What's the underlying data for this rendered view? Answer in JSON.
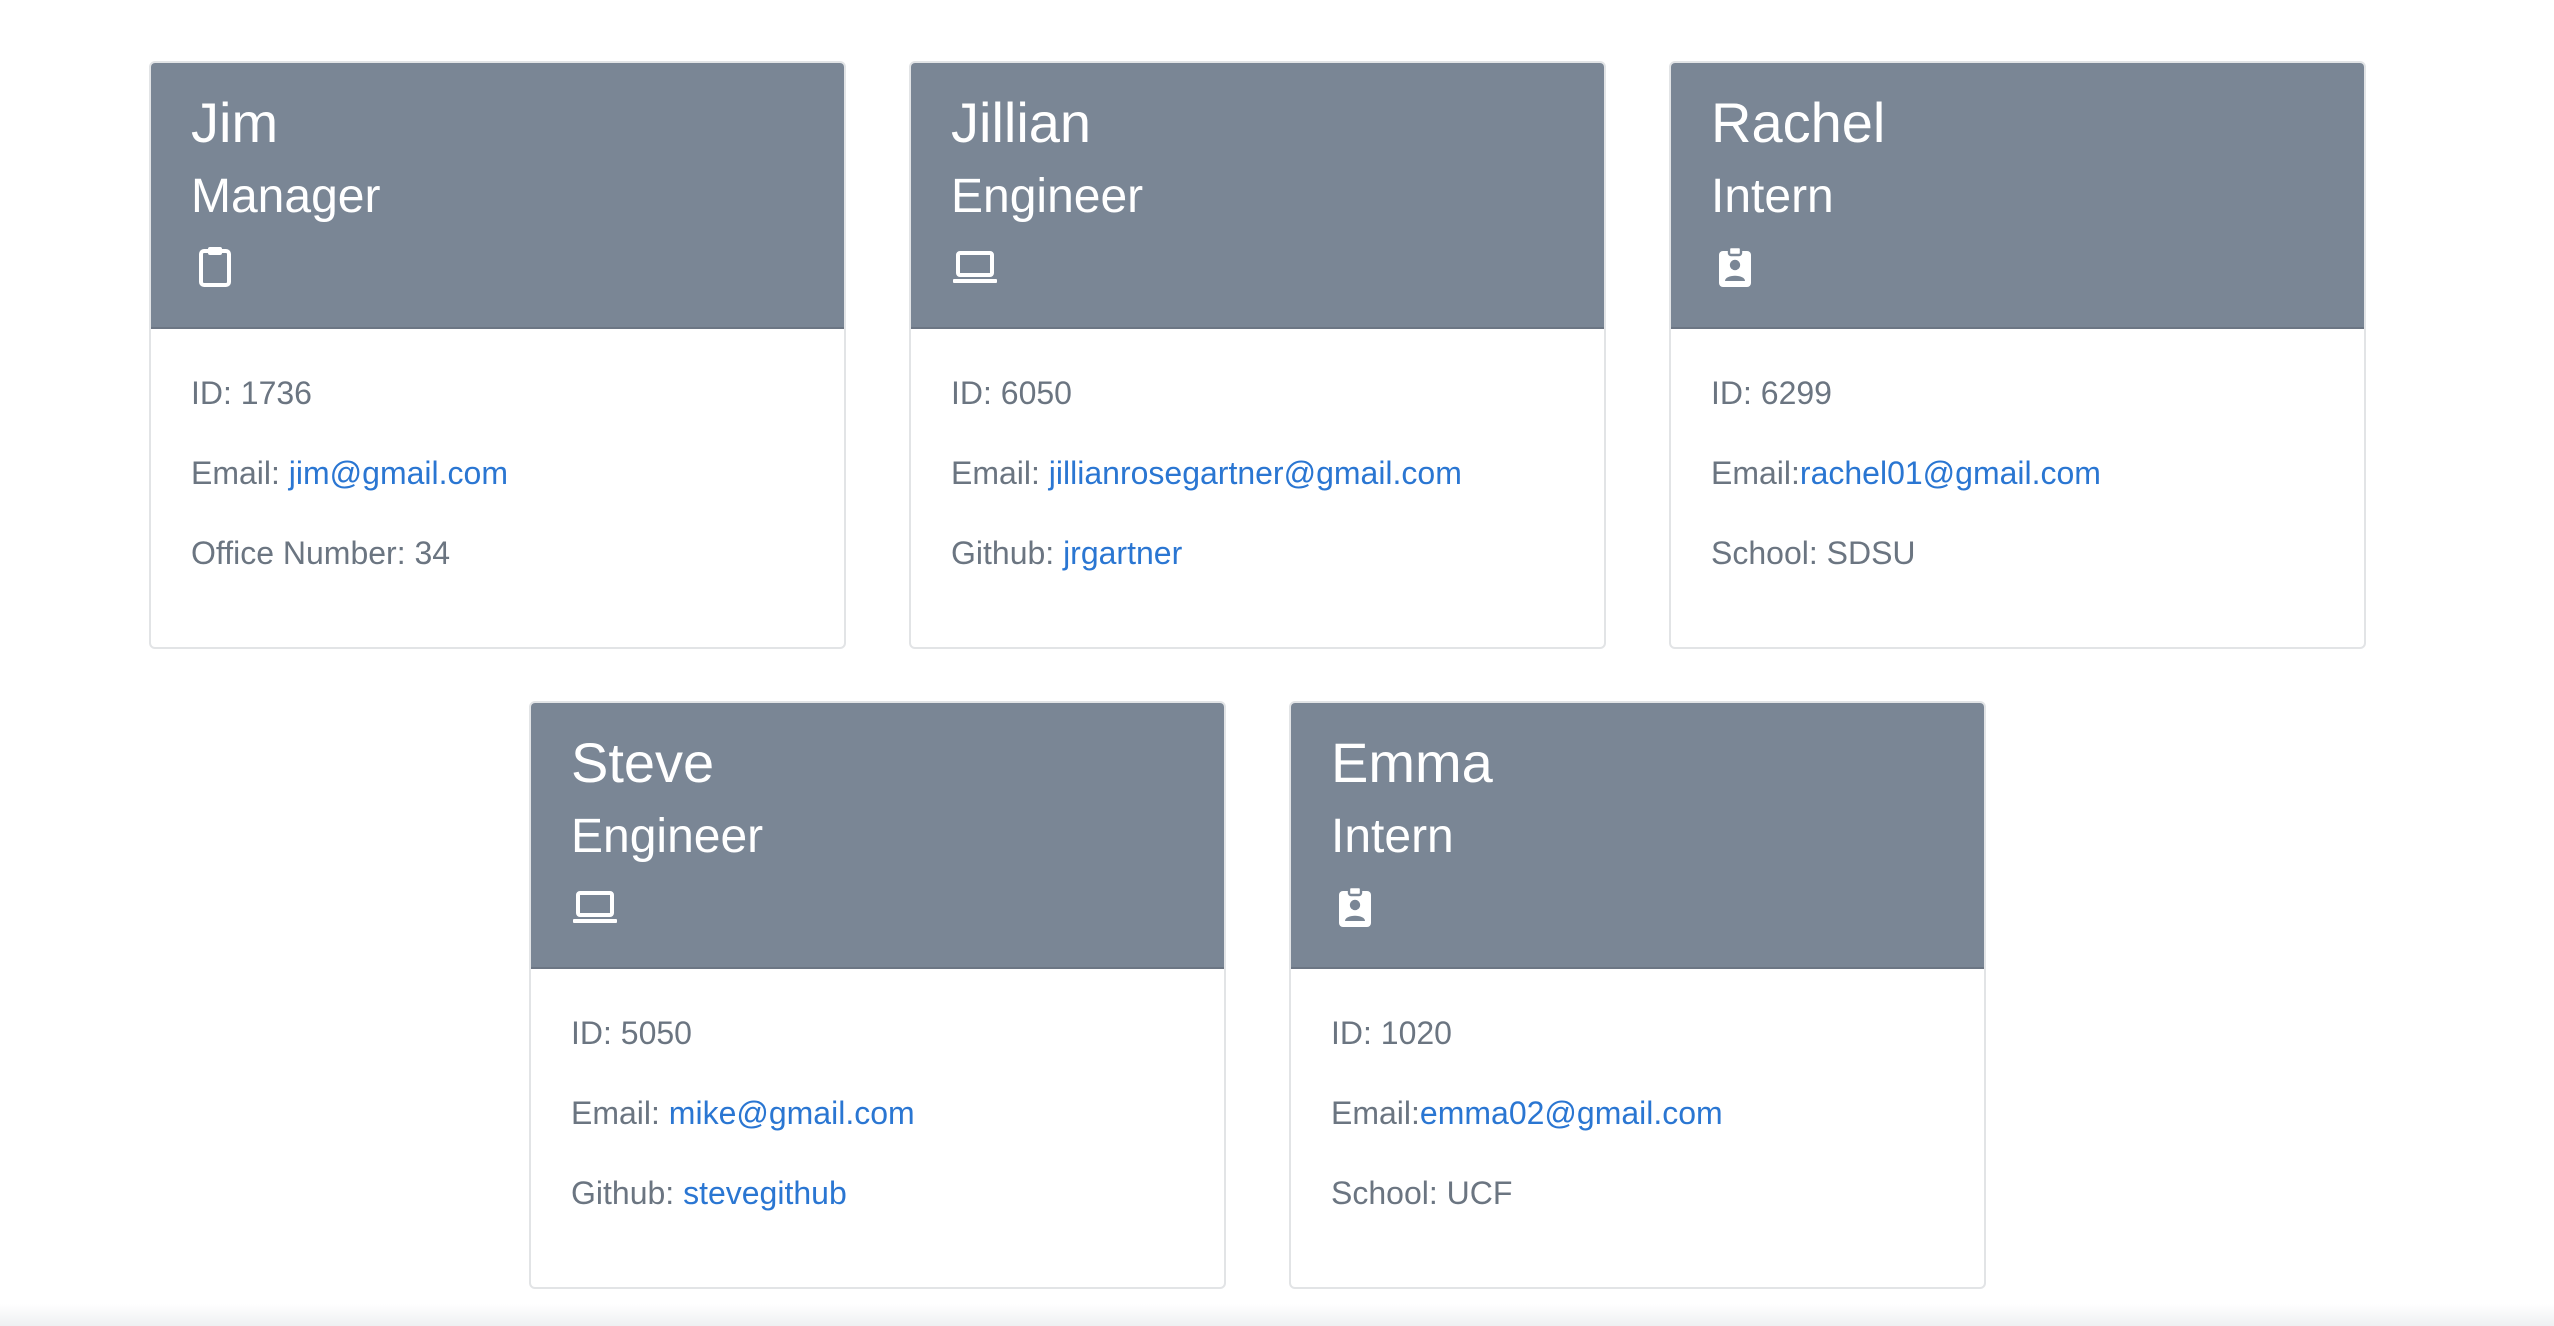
{
  "cards": [
    {
      "name": "Jim",
      "role": "Manager",
      "icon": "clipboard-icon",
      "id_label": "ID: 1736",
      "email_label": "Email: ",
      "email": "jim@gmail.com",
      "extra_label": "Office Number: 34",
      "extra_link": ""
    },
    {
      "name": "Jillian",
      "role": "Engineer",
      "icon": "laptop-icon",
      "id_label": "ID: 6050",
      "email_label": "Email: ",
      "email": "jillianrosegartner@gmail.com",
      "extra_label": "Github: ",
      "extra_link": "jrgartner"
    },
    {
      "name": "Rachel",
      "role": "Intern",
      "icon": "id-badge-icon",
      "id_label": "ID: 6299",
      "email_label": "Email:",
      "email": "rachel01@gmail.com",
      "extra_label": "School: SDSU",
      "extra_link": ""
    },
    {
      "name": "Steve",
      "role": "Engineer",
      "icon": "laptop-icon",
      "id_label": "ID: 5050",
      "email_label": "Email: ",
      "email": "mike@gmail.com",
      "extra_label": "Github: ",
      "extra_link": "stevegithub"
    },
    {
      "name": "Emma",
      "role": "Intern",
      "icon": "id-badge-icon",
      "id_label": "ID: 1020",
      "email_label": "Email:",
      "email": "emma02@gmail.com",
      "extra_label": "School: UCF",
      "extra_link": ""
    }
  ],
  "colors": {
    "header_bg": "#7a8695",
    "link": "#2a76d2",
    "body_text": "#6b7581"
  }
}
